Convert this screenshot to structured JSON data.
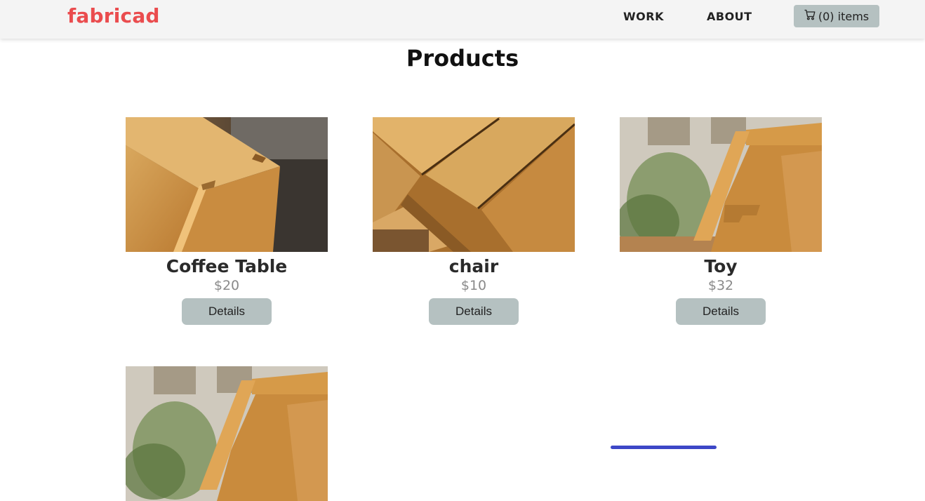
{
  "nav": {
    "brand": "fabricad",
    "links": [
      {
        "label": "WORK"
      },
      {
        "label": "ABOUT"
      }
    ],
    "cart": {
      "label": "(0) items",
      "icon": "cart-icon"
    }
  },
  "page": {
    "title": "Products"
  },
  "products": [
    {
      "name": "Coffee Table",
      "price": "$20",
      "button": "Details",
      "image": "wood-joint-photo"
    },
    {
      "name": "chair",
      "price": "$10",
      "button": "Details",
      "image": "wood-slats-photo"
    },
    {
      "name": "Toy",
      "price": "$32",
      "button": "Details",
      "image": "wood-toy-photo"
    },
    {
      "name": "",
      "price": "",
      "button": "",
      "image": "wood-toy-photo"
    }
  ],
  "colors": {
    "brand": "#ea4c4e",
    "nav_bg": "#f4f4f4",
    "button_bg": "#b5c1c1",
    "scroll_indicator": "#3d47c7"
  }
}
